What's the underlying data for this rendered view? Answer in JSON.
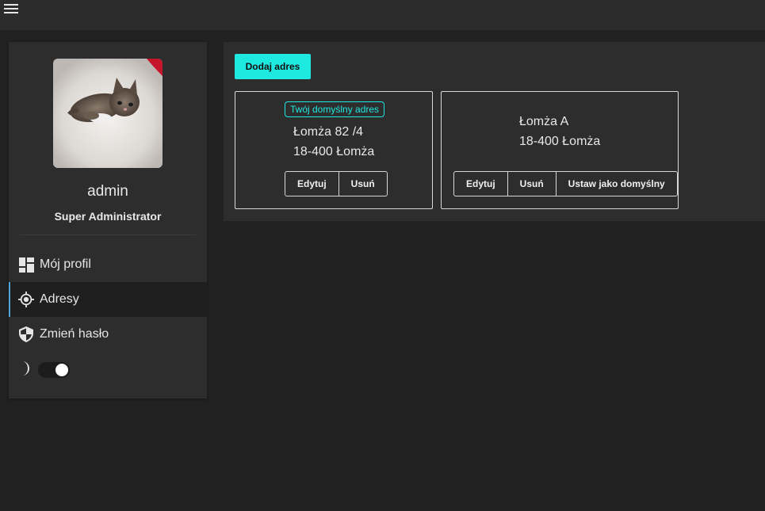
{
  "header": {
    "menu_icon": "hamburger-menu-icon"
  },
  "profile": {
    "avatar_alt": "kitten",
    "username": "admin",
    "role": "Super Administrator"
  },
  "sidebar": {
    "items": [
      {
        "label": "Mój profil",
        "icon": "dashboard-icon",
        "active": false
      },
      {
        "label": "Adresy",
        "icon": "location-target-icon",
        "active": true
      },
      {
        "label": "Zmień hasło",
        "icon": "shield-icon",
        "active": false
      }
    ],
    "theme_toggle": {
      "icon": "moon-icon",
      "on": true
    }
  },
  "main": {
    "add_button": "Dodaj adres",
    "addresses": [
      {
        "badge": "Twój domyślny adres",
        "line1": "Łomża 82 /4",
        "line2": "18-400 Łomża",
        "actions": [
          "Edytuj",
          "Usuń"
        ]
      },
      {
        "line1": "Łomża A",
        "line2": "18-400 Łomża",
        "actions": [
          "Edytuj",
          "Usuń",
          "Ustaw jako domyślny"
        ]
      }
    ]
  },
  "colors": {
    "accent": "#1de9e0",
    "background": "#212121",
    "panel": "#2d2d2d",
    "active_indicator": "#4fa3d9"
  }
}
